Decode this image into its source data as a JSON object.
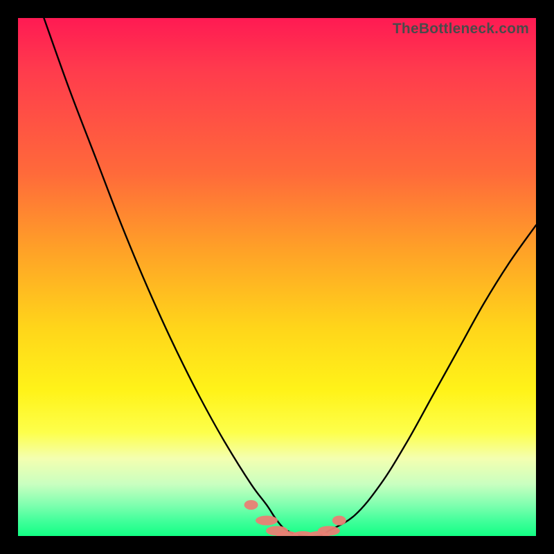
{
  "watermark": "TheBottleneck.com",
  "chart_data": {
    "type": "line",
    "title": "",
    "xlabel": "",
    "ylabel": "",
    "xlim": [
      0,
      100
    ],
    "ylim": [
      0,
      100
    ],
    "grid": false,
    "legend": false,
    "series": [
      {
        "name": "bottleneck-curve",
        "color": "#000000",
        "x": [
          5,
          10,
          15,
          20,
          25,
          30,
          35,
          40,
          45,
          48,
          50,
          52,
          55,
          58,
          60,
          65,
          70,
          75,
          80,
          85,
          90,
          95,
          100
        ],
        "y": [
          100,
          86,
          73,
          60,
          48,
          37,
          27,
          18,
          10,
          6,
          3,
          1,
          0,
          0,
          1,
          4,
          10,
          18,
          27,
          36,
          45,
          53,
          60
        ]
      }
    ],
    "annotations": [
      {
        "name": "optimal-band-markers",
        "type": "marker-run",
        "color": "#e98074",
        "x": [
          45,
          48,
          50,
          52,
          55,
          58,
          60,
          62
        ],
        "y": [
          6,
          3,
          1,
          0,
          0,
          0,
          1,
          3
        ]
      }
    ],
    "background_gradient": {
      "top": "#ff1a53",
      "mid1": "#ffa227",
      "mid2": "#fff319",
      "bottom": "#12ff84"
    }
  }
}
